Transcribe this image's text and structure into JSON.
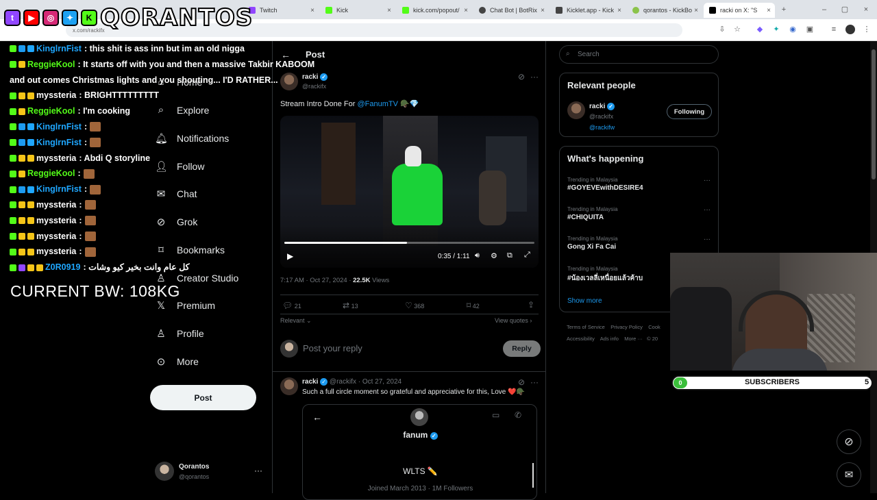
{
  "browser": {
    "tabs": [
      {
        "label": "",
        "color": "#9146ff"
      },
      {
        "label": "Twitch",
        "color": "#9146ff"
      },
      {
        "label": "Kick",
        "color": "#53fc18"
      },
      {
        "label": "kick.com/popout/",
        "color": "#53fc18"
      },
      {
        "label": "Chat Bot | BotRix",
        "color": "#333"
      },
      {
        "label": "Kicklet.app - Kick",
        "color": "#333"
      },
      {
        "label": "qorantos - KickBo",
        "color": "#8bc34a"
      },
      {
        "label": "racki on X: \"S",
        "color": "#000"
      }
    ],
    "url": "x.com/rackifx"
  },
  "overlay": {
    "logo_text": "QORANTOS",
    "bandwidth": "CURRENT BW: 108KG",
    "chat": [
      {
        "user": "KinglrnFist",
        "msg": ": this shit is ass inn but im an old nigga",
        "color": "#1fa7ff",
        "badges": [
          "#53fc18",
          "#1d9bf0",
          "#1fa7ff"
        ]
      },
      {
        "user": "ReggieKool",
        "msg": ": It starts off with you and then a massive Takbir KABOOM",
        "color": "#53fc18",
        "badges": [
          "#53fc18",
          "#f5c518"
        ]
      },
      {
        "user": "",
        "msg": "and out comes Christmas lights and you shouting... I'D RATHER...",
        "color": "#fff",
        "badges": []
      },
      {
        "user": "myssteria",
        "msg": ": BRIGHTTTTTTTTT",
        "color": "#fff",
        "badges": [
          "#53fc18",
          "#f5c518",
          "#f5c518"
        ]
      },
      {
        "user": "ReggieKool",
        "msg": ": I'm cooking",
        "color": "#53fc18",
        "badges": [
          "#53fc18",
          "#f5c518"
        ]
      },
      {
        "user": "KinglrnFist",
        "msg": ":",
        "color": "#1fa7ff",
        "badges": [
          "#53fc18",
          "#1d9bf0",
          "#1fa7ff"
        ]
      },
      {
        "user": "KinglrnFist",
        "msg": ":",
        "color": "#1fa7ff",
        "badges": [
          "#53fc18",
          "#1d9bf0",
          "#1fa7ff"
        ]
      },
      {
        "user": "myssteria",
        "msg": ": Abdi Q storyline",
        "color": "#fff",
        "badges": [
          "#53fc18",
          "#f5c518",
          "#f5c518"
        ]
      },
      {
        "user": "ReggieKool",
        "msg": ":",
        "color": "#53fc18",
        "badges": [
          "#53fc18",
          "#f5c518"
        ]
      },
      {
        "user": "KinglrnFist",
        "msg": ":",
        "color": "#1fa7ff",
        "badges": [
          "#53fc18",
          "#1d9bf0",
          "#1fa7ff"
        ]
      },
      {
        "user": "myssteria",
        "msg": ":",
        "color": "#fff",
        "badges": [
          "#53fc18",
          "#f5c518",
          "#f5c518"
        ]
      },
      {
        "user": "myssteria",
        "msg": ":",
        "color": "#fff",
        "badges": [
          "#53fc18",
          "#f5c518",
          "#f5c518"
        ]
      },
      {
        "user": "myssteria",
        "msg": ":",
        "color": "#fff",
        "badges": [
          "#53fc18",
          "#f5c518",
          "#f5c518"
        ]
      },
      {
        "user": "myssteria",
        "msg": ":",
        "color": "#fff",
        "badges": [
          "#53fc18",
          "#f5c518",
          "#f5c518"
        ]
      },
      {
        "user": "Z0R0919",
        "msg": ": كل عام وانت بخير كيو وشات",
        "color": "#1fa7ff",
        "badges": [
          "#53fc18",
          "#9146ff",
          "#f5c518",
          "#f5c518"
        ]
      }
    ]
  },
  "nav": {
    "items": [
      "Home",
      "Explore",
      "Notifications",
      "Follow",
      "Chat",
      "Grok",
      "Bookmarks",
      "Creator Studio",
      "Premium",
      "Profile",
      "More"
    ],
    "post_label": "Post",
    "account_name": "Qorantos",
    "account_handle": "@qorantos"
  },
  "post": {
    "header": "Post",
    "author": "racki",
    "handle": "@rackifx",
    "text": "Stream Intro Done For",
    "mention": "@FanumTV",
    "time": "0:35 / 1:11",
    "progress": 0.49,
    "meta_time": "7:17 AM · Oct 27, 2024 · ",
    "views_count": "22.5K",
    "views_label": " Views",
    "replies": "21",
    "reposts": "13",
    "likes": "368",
    "bookmarks": "42",
    "sort_label": "Relevant",
    "quotes_label": "View quotes",
    "reply_placeholder": "Post your reply",
    "reply_button": "Reply"
  },
  "reply": {
    "author": "racki",
    "handle": "@rackifx · Oct 27, 2024",
    "text": "Such a full circle moment so grateful and appreciative for this, Love",
    "card_name": "fanum",
    "card_bio": "WLTS",
    "card_joined": "Joined March 2013 · 1M Followers"
  },
  "sidebar": {
    "search_placeholder": "Search",
    "relevant_title": "Relevant people",
    "person_name": "racki",
    "person_handle": "@rackifx",
    "person_bio": "@rackifw",
    "follow_label": "Following",
    "happening_title": "What's happening",
    "trends": [
      {
        "cat": "Trending in Malaysia",
        "name": "#GOYEVEwithDESIRE4"
      },
      {
        "cat": "Trending in Malaysia",
        "name": "#CHIQUITA"
      },
      {
        "cat": "Trending in Malaysia",
        "name": "Gong Xi Fa Cai"
      },
      {
        "cat": "Trending in Malaysia",
        "name": "#น้องเวลลี่เหนื่อยแล้วค้าบ"
      }
    ],
    "show_more": "Show more",
    "footer": [
      "Terms of Service",
      "Privacy Policy",
      "Cook",
      "Accessibility",
      "Ads info",
      "More ···",
      "© 20"
    ]
  },
  "subs": {
    "left": "0",
    "label": "SUBSCRIBERS",
    "right": "5"
  }
}
